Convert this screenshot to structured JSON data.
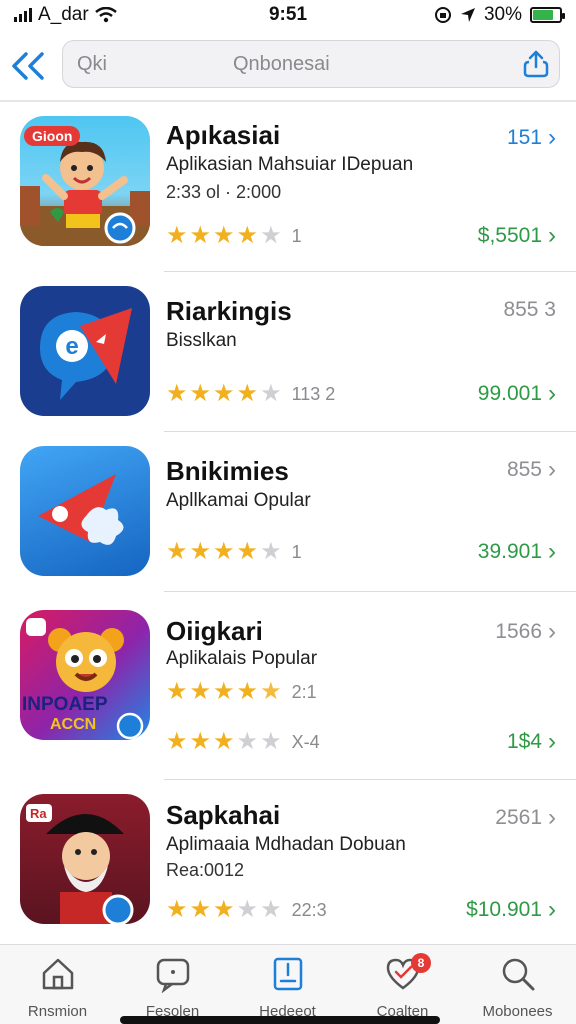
{
  "status_bar": {
    "carrier": "A_dar",
    "time": "9:51",
    "battery": "30%",
    "battery_level": 0.75
  },
  "search": {
    "placeholder_left": "Qki",
    "query": "Qnbonesai"
  },
  "apps": [
    {
      "title": "Apıkasiai",
      "subtitle": "Aplikasian Mahsuiar IDepuan",
      "meta": "2:33 ol · 2:000",
      "rating": 4,
      "rating_count": "1",
      "rank": "151",
      "price": "$,5501",
      "icon_text": "Gioon"
    },
    {
      "title": "Riarkingis",
      "subtitle": "Bisslkan",
      "meta": "",
      "rating": 4,
      "rating_count": "113 2",
      "rank": "855 3",
      "price": "99.001"
    },
    {
      "title": "Bnikimies",
      "subtitle": "Apllkamai Opular",
      "meta": "",
      "rating": 4,
      "rating_count": "1",
      "rank": "855",
      "price": "39.901"
    },
    {
      "title": "Oiigkari",
      "subtitle": "Aplikalais Popular",
      "meta": "",
      "rating": 4.5,
      "rating_count": "2:1",
      "rating2": 3.5,
      "rating2_count": "X-4",
      "rank": "1566",
      "price": "1$4",
      "icon_text_1": "INPOAEP",
      "icon_text_2": "ACCN"
    },
    {
      "title": "Sapkahai",
      "subtitle": "Aplimaaia Mdhadan Dobuan",
      "meta": "Rea:0012",
      "rating": 3.5,
      "rating_count": "22:3",
      "rank": "2561",
      "price": "$10.901",
      "icon_text": "Ra"
    }
  ],
  "tabs": [
    {
      "label": "Rnsmion",
      "icon": "home-icon"
    },
    {
      "label": "Fesolen",
      "icon": "message-icon"
    },
    {
      "label": "Hedeeot",
      "icon": "document-icon"
    },
    {
      "label": "Coalten",
      "icon": "heart-check-icon",
      "badge": "8"
    },
    {
      "label": "Mobonees",
      "icon": "search-icon"
    }
  ],
  "colors": {
    "accent": "#1e7fd8",
    "star": "#f2b01e",
    "price": "#2f9a46",
    "badge": "#e53935"
  }
}
